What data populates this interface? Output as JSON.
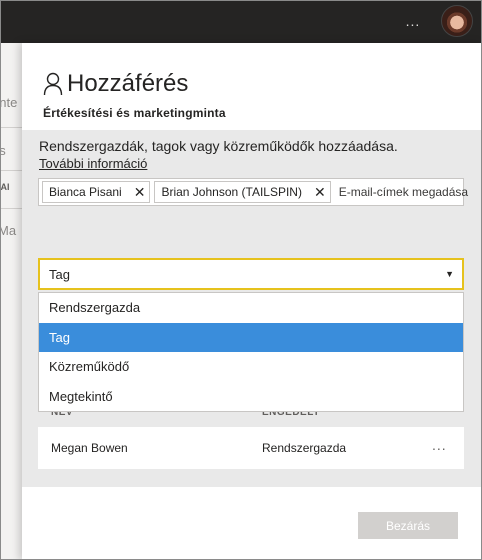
{
  "topbar": {
    "more_label": "...",
    "avatar": "user-avatar"
  },
  "background": {
    "fragments": [
      "onte",
      "ds",
      "NAI",
      "Ma"
    ]
  },
  "panel": {
    "title": "Hozzáférés",
    "title_icon": "person-icon",
    "subtitle": "Értékesítési és marketingminta",
    "description": "Rendszergazdák, tagok vagy közreműködők hozzáadása.",
    "learn_more": "További információ",
    "recipients": [
      {
        "name": "Bianca Pisani",
        "remove_icon": "close-icon"
      },
      {
        "name": "Brian Johnson (TAILSPIN)",
        "remove_icon": "close-icon"
      }
    ],
    "email_placeholder": "E-mail-címek megadása",
    "role_select": {
      "value": "Tag",
      "options": [
        "Rendszergazda",
        "Tag",
        "Közreműködő",
        "Megtekintő"
      ],
      "selected_index": 1
    },
    "table": {
      "col_name": "NÉV",
      "col_permission": "ENGEDÉLY",
      "rows": [
        {
          "name": "Megan Bowen",
          "permission": "Rendszergazda",
          "more": "..."
        }
      ]
    },
    "close_label": "Bezárás"
  },
  "colors": {
    "topbar": "#252423",
    "select_border": "#e6c21d",
    "selected_option": "#3a8ddb",
    "gray_area": "#e9e9e9",
    "close_button": "#d2d0ce"
  }
}
